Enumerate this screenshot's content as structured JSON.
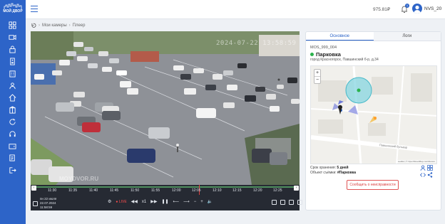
{
  "app": {
    "logo_text": "МОЙ ДВОР"
  },
  "sidebar": {
    "items": [
      {
        "icon": "dashboard-icon"
      },
      {
        "icon": "video-camera-icon"
      },
      {
        "icon": "lock-icon"
      },
      {
        "icon": "intercom-icon"
      },
      {
        "icon": "building-icon"
      },
      {
        "icon": "users-icon"
      },
      {
        "icon": "house-icon"
      },
      {
        "icon": "refresh-icon"
      },
      {
        "icon": "headset-icon"
      },
      {
        "icon": "wallet-icon"
      },
      {
        "icon": "documents-icon"
      },
      {
        "icon": "logout-icon"
      }
    ],
    "accent": "#2d64c8"
  },
  "header": {
    "balance": "975.81₽",
    "notifications": "1",
    "username": "NVS_20"
  },
  "breadcrumb": {
    "items": [
      "Мои камеры",
      "Плеер"
    ]
  },
  "video": {
    "osd_datetime": "2024-07-22 13:58:59",
    "watermark": "MOYDVOR.RU"
  },
  "timeline": {
    "labels": [
      "11:30",
      "11:35",
      "11:40",
      "11:45",
      "11:50",
      "11:55",
      "12:00",
      "12:05",
      "12:10",
      "12:15",
      "12:20",
      "12:25"
    ]
  },
  "controls": {
    "date_line1": "пн 22 июля",
    "date_line2": "22.07.2024",
    "time": "11:58:59",
    "live_label": "LIVE",
    "speed_label": "x1",
    "prev_label": "◀◀",
    "next_label": "▶▶",
    "pause_label": "❚❚",
    "seek_back": "⟵",
    "seek_fwd": "⟶",
    "minus": "−",
    "plus": "+",
    "volume": "🔈"
  },
  "panel": {
    "tabs": [
      "Основное",
      "Логи"
    ],
    "camera_id": "MOS_999_004",
    "camera_name": "Парковка",
    "status_color": "#2bb24c",
    "address": "город Красногорск, Павшинский б-р, д.34",
    "map": {
      "zoom_in": "+",
      "zoom_out": "−",
      "street": "Павшинский бульвар",
      "attribution": "Leaflet | © OpenStreetMap contributors"
    },
    "storage_label": "Срок хранения: ",
    "storage_value": "5 дней",
    "object_label": "Объект съёмки: ",
    "object_value": "#Парковка",
    "report_button": "Сообщить о неисправности"
  }
}
